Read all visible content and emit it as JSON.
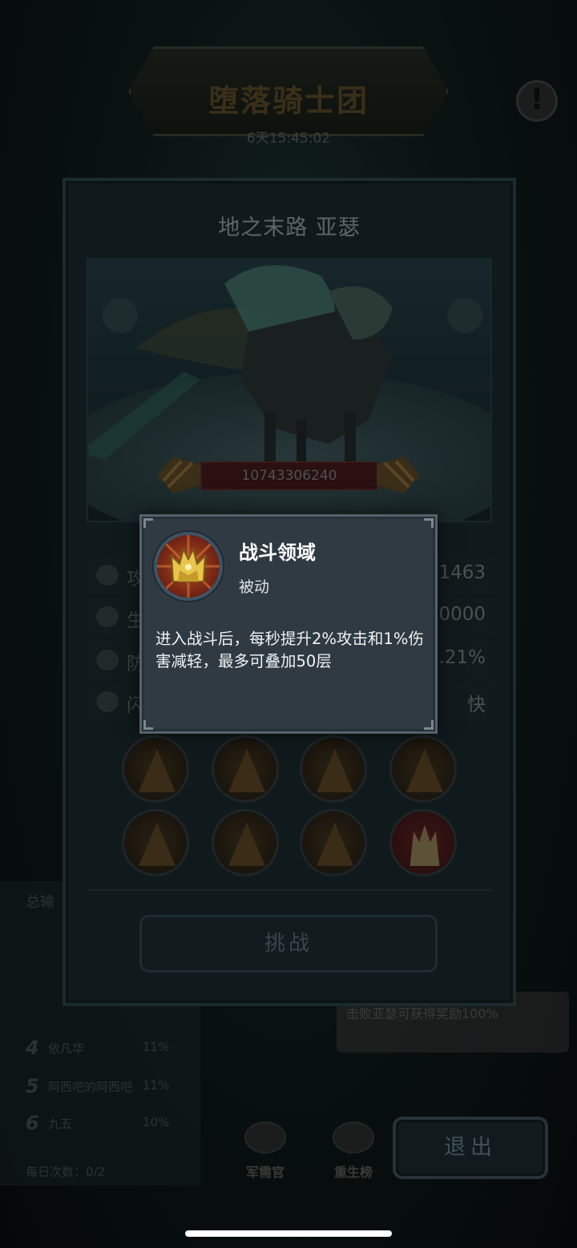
{
  "event": {
    "title": "堕落骑士团",
    "timer": "6天15:45:02",
    "alert_icon": "exclamation-icon"
  },
  "boss": {
    "name": "地之末路 亚瑟",
    "hp": "10743306240",
    "stats": [
      {
        "label": "攻",
        "value": "1463",
        "icon": "sword-icon"
      },
      {
        "label": "生",
        "value": "0000",
        "icon": "heart-icon"
      },
      {
        "label": "防",
        "value": ".21%",
        "icon": "shield-icon"
      },
      {
        "label": "闪",
        "value": "快",
        "icon": "speed-icon"
      }
    ],
    "skills": [
      {
        "icon": "locked-skill-icon",
        "active": false
      },
      {
        "icon": "locked-skill-icon",
        "active": false
      },
      {
        "icon": "locked-skill-icon",
        "active": false
      },
      {
        "icon": "locked-skill-icon",
        "active": false
      },
      {
        "icon": "locked-skill-icon",
        "active": false
      },
      {
        "icon": "locked-skill-icon",
        "active": false
      },
      {
        "icon": "locked-skill-icon",
        "active": false
      },
      {
        "icon": "crown-skill-icon",
        "active": true
      }
    ],
    "challenge_label": "挑战"
  },
  "tooltip": {
    "title": "战斗领域",
    "type": "被动",
    "description": "进入战斗后，每秒提升2%攻击和1%伤害减轻，最多可叠加50层"
  },
  "ranking": {
    "title": "总输",
    "rows": [
      {
        "num": "4",
        "name": "依凡华",
        "pct": "11%"
      },
      {
        "num": "5",
        "name": "阿西吧的阿西吧",
        "pct": "11%"
      },
      {
        "num": "6",
        "name": "九五",
        "pct": "10%"
      }
    ],
    "daily": "每日次数：0/2"
  },
  "bottom": {
    "note": "击败亚瑟可获得奖励100%",
    "nav": [
      "军需官",
      "重生榜"
    ],
    "exit_label": "退出"
  },
  "colors": {
    "tooltip_bg": "#2f3a43",
    "tooltip_border": "#55626b",
    "hp_bar": "#2a1010"
  }
}
